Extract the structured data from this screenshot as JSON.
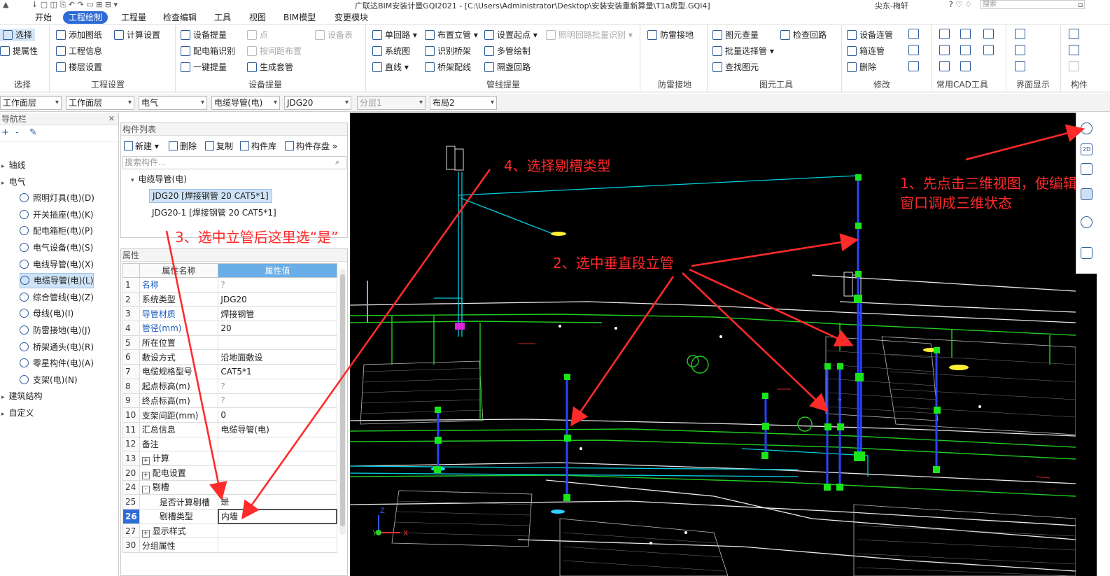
{
  "title": "广联达BIM安装计量GQI2021 - [C:\\Users\\Administrator\\Desktop\\安装安装重新算量\\T1a房型.GQI4]",
  "user": "尖东-梅轩",
  "search_placeholder": "搜索",
  "menu": [
    "开始",
    "工程绘制",
    "工程量",
    "检查编辑",
    "工具",
    "视图",
    "BIM模型",
    "变更模块"
  ],
  "ribbon": {
    "select": {
      "btn1": "选择",
      "btn2": "提属性",
      "label": "选择"
    },
    "project": {
      "btn1": "添加图纸",
      "btn2": "工程信息",
      "btn3": "楼层设置",
      "btn4": "计算设置",
      "label": "工程设置"
    },
    "device": {
      "btn1": "设备提量",
      "btn2": "配电箱识别",
      "btn3": "一键提量",
      "btn4": "点",
      "btn5": "按间距布置",
      "btn6": "生成套管",
      "btn7": "设备表",
      "label": "设备提量"
    },
    "pipeline": {
      "btn1": "单回路",
      "btn2": "系统图",
      "btn3": "直线",
      "btn4": "布置立管",
      "btn5": "识别桥架",
      "btn6": "桥架配线",
      "btn7": "设置起点",
      "btn8": "多管绘制",
      "btn9": "隔盏回路",
      "btn10": "照明回路批量识别",
      "label": "管线提量"
    },
    "lightning": {
      "btn1": "防雷接地",
      "label": "防雷接地"
    },
    "element": {
      "btn1": "图元查量",
      "btn2": "批量选择管",
      "btn3": "查找图元",
      "btn4": "检查回路",
      "label": "图元工具"
    },
    "modify": {
      "btn1": "设备连管",
      "btn2": "箱连管",
      "btn3": "删除",
      "label": "修改"
    },
    "cad": {
      "label": "常用CAD工具"
    },
    "display": {
      "label": "界面显示"
    },
    "struct": {
      "label": "构件"
    }
  },
  "filters": [
    "工作面层",
    "工作面层",
    "电气",
    "电缆导管(电)",
    "JDG20",
    "分层1",
    "布局2"
  ],
  "nav": {
    "title": "导航栏",
    "items": [
      {
        "label": "轴线",
        "level": 0
      },
      {
        "label": "电气",
        "level": 0
      },
      {
        "label": "照明灯具(电)(D)",
        "level": 1
      },
      {
        "label": "开关插座(电)(K)",
        "level": 1
      },
      {
        "label": "配电箱柜(电)(P)",
        "level": 1
      },
      {
        "label": "电气设备(电)(S)",
        "level": 1
      },
      {
        "label": "电线导管(电)(X)",
        "level": 1
      },
      {
        "label": "电缆导管(电)(L)",
        "level": 1,
        "selected": true
      },
      {
        "label": "综合管线(电)(Z)",
        "level": 1
      },
      {
        "label": "母线(电)(I)",
        "level": 1
      },
      {
        "label": "防雷接地(电)(J)",
        "level": 1
      },
      {
        "label": "桥架通头(电)(R)",
        "level": 1
      },
      {
        "label": "零星构件(电)(A)",
        "level": 1
      },
      {
        "label": "支架(电)(N)",
        "level": 1
      },
      {
        "label": "建筑结构",
        "level": 0
      },
      {
        "label": "自定义",
        "level": 0
      }
    ]
  },
  "complist": {
    "title": "构件列表",
    "tools": [
      "新建",
      "删除",
      "复制",
      "构件库",
      "构件存盘"
    ],
    "search_placeholder": "搜索构件...",
    "group": "电缆导管(电)",
    "items": [
      "JDG20 [焊接钢管 20 CAT5*1]",
      "JDG20-1 [焊接钢管 20 CAT5*1]"
    ]
  },
  "props": {
    "title": "属性",
    "headers": [
      "属性名称",
      "属性值"
    ],
    "rows": [
      {
        "n": "1",
        "k": "名称",
        "v": "?",
        "blue": true
      },
      {
        "n": "2",
        "k": "系统类型",
        "v": "JDG20"
      },
      {
        "n": "3",
        "k": "导管材质",
        "v": "焊接钢管",
        "blue": true
      },
      {
        "n": "4",
        "k": "管径(mm)",
        "v": "20",
        "blue": true
      },
      {
        "n": "5",
        "k": "所在位置",
        "v": ""
      },
      {
        "n": "6",
        "k": "敷设方式",
        "v": "沿地面敷设"
      },
      {
        "n": "7",
        "k": "电缆规格型号",
        "v": "CAT5*1"
      },
      {
        "n": "8",
        "k": "起点标高(m)",
        "v": "?"
      },
      {
        "n": "9",
        "k": "终点标高(m)",
        "v": "?"
      },
      {
        "n": "10",
        "k": "支架间距(mm)",
        "v": "0"
      },
      {
        "n": "11",
        "k": "汇总信息",
        "v": "电缆导管(电)"
      },
      {
        "n": "12",
        "k": "备注",
        "v": ""
      },
      {
        "n": "13",
        "k": "计算",
        "v": "",
        "pm": "+"
      },
      {
        "n": "20",
        "k": "配电设置",
        "v": "",
        "pm": "+"
      },
      {
        "n": "24",
        "k": "剔槽",
        "v": "",
        "pm": "-"
      },
      {
        "n": "25",
        "k": "是否计算剔槽",
        "v": "是",
        "indent": true
      },
      {
        "n": "26",
        "k": "剔槽类型",
        "v": "内墙",
        "indent": true,
        "current": true
      },
      {
        "n": "27",
        "k": "显示样式",
        "v": "",
        "pm": "+"
      },
      {
        "n": "30",
        "k": "分组属性",
        "v": ""
      }
    ]
  },
  "annotations": {
    "a1": "1、先点击三维视图，使编辑",
    "a1b": "窗口调成三维状态",
    "a2": "2、选中垂直段立管",
    "a3": "3、选中立管后这里选“是”",
    "a4": "4、选择剔槽类型"
  },
  "axes": {
    "x": "X",
    "y": "Y",
    "z": "Z"
  },
  "colors": {
    "accent": "#2d6bd6",
    "annotation": "#ff2a2a",
    "pipe": "#2244ff",
    "handle": "#19e619"
  }
}
